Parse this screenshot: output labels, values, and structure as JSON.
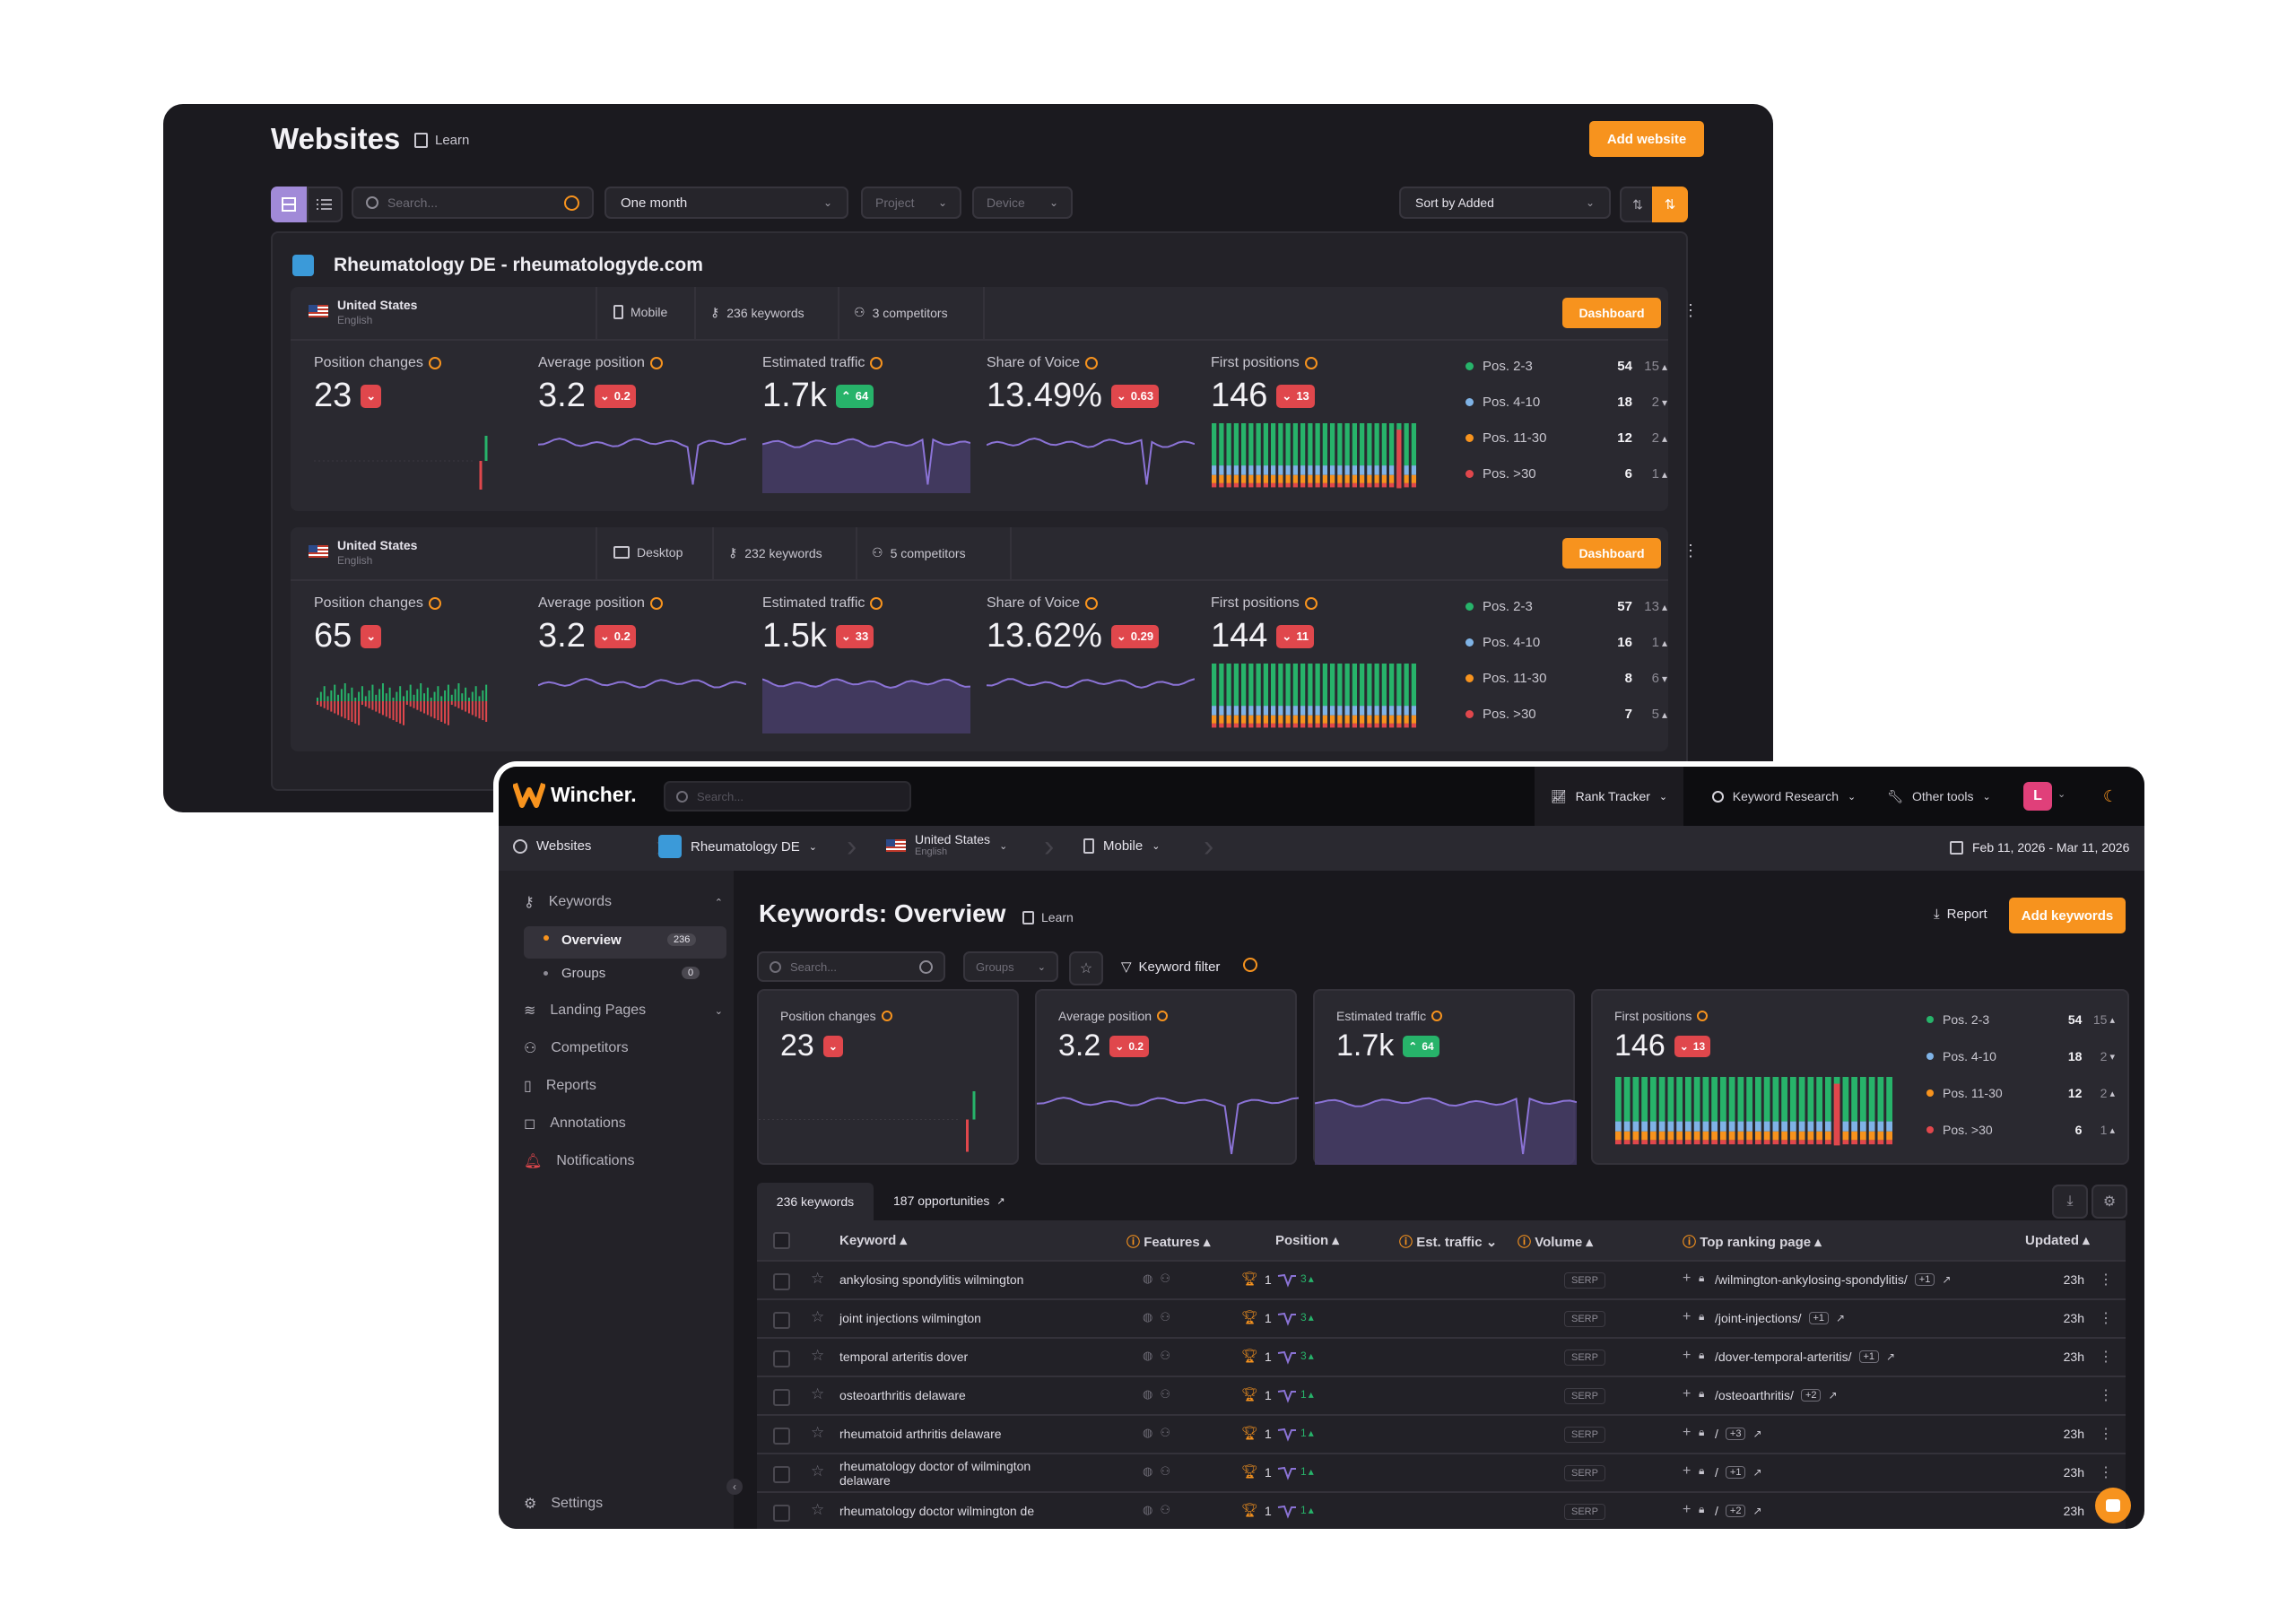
{
  "back": {
    "title": "Websites",
    "learn": "Learn",
    "add_website": "Add website",
    "search_placeholder": "Search...",
    "period": "One month",
    "project": "Project",
    "device": "Device",
    "sort": "Sort by Added",
    "site_title": "Rheumatology DE - rheumatologyde.com",
    "panels": [
      {
        "country": "United States",
        "language": "English",
        "device": "Mobile",
        "keywords": "236 keywords",
        "competitors": "3 competitors",
        "dashboard": "Dashboard",
        "metrics": [
          {
            "label": "Position changes",
            "value": "23",
            "badge": "",
            "dir": "down"
          },
          {
            "label": "Average position",
            "value": "3.2",
            "badge": "0.2",
            "dir": "down"
          },
          {
            "label": "Estimated traffic",
            "value": "1.7k",
            "badge": "64",
            "dir": "up"
          },
          {
            "label": "Share of Voice",
            "value": "13.49%",
            "badge": "0.63",
            "dir": "down"
          },
          {
            "label": "First positions",
            "value": "146",
            "badge": "13",
            "dir": "down"
          }
        ],
        "positions": [
          {
            "label": "Pos. 2-3",
            "value": "54",
            "delta": "15",
            "dir": "up",
            "color": "#27b36a"
          },
          {
            "label": "Pos. 4-10",
            "value": "18",
            "delta": "2",
            "dir": "down",
            "color": "#7fb3e6"
          },
          {
            "label": "Pos. 11-30",
            "value": "12",
            "delta": "2",
            "dir": "up",
            "color": "#f7931e"
          },
          {
            "label": "Pos. >30",
            "value": "6",
            "delta": "1",
            "dir": "up",
            "color": "#e0474c"
          }
        ]
      },
      {
        "country": "United States",
        "language": "English",
        "device": "Desktop",
        "keywords": "232 keywords",
        "competitors": "5 competitors",
        "dashboard": "Dashboard",
        "metrics": [
          {
            "label": "Position changes",
            "value": "65",
            "badge": "",
            "dir": "down"
          },
          {
            "label": "Average position",
            "value": "3.2",
            "badge": "0.2",
            "dir": "down"
          },
          {
            "label": "Estimated traffic",
            "value": "1.5k",
            "badge": "33",
            "dir": "down"
          },
          {
            "label": "Share of Voice",
            "value": "13.62%",
            "badge": "0.29",
            "dir": "down"
          },
          {
            "label": "First positions",
            "value": "144",
            "badge": "11",
            "dir": "down"
          }
        ],
        "positions": [
          {
            "label": "Pos. 2-3",
            "value": "57",
            "delta": "13",
            "dir": "up",
            "color": "#27b36a"
          },
          {
            "label": "Pos. 4-10",
            "value": "16",
            "delta": "1",
            "dir": "up",
            "color": "#7fb3e6"
          },
          {
            "label": "Pos. 11-30",
            "value": "8",
            "delta": "6",
            "dir": "down",
            "color": "#f7931e"
          },
          {
            "label": "Pos. >30",
            "value": "7",
            "delta": "5",
            "dir": "up",
            "color": "#e0474c"
          }
        ]
      }
    ]
  },
  "front": {
    "brand": "Wincher.",
    "search_placeholder": "Search...",
    "nav": {
      "rank_tracker": "Rank Tracker",
      "keyword_research": "Keyword Research",
      "other_tools": "Other tools",
      "avatar": "L"
    },
    "breadcrumb": {
      "websites": "Websites",
      "site": "Rheumatology DE",
      "country": "United States",
      "language": "English",
      "device": "Mobile"
    },
    "date_range": "Feb 11, 2026 - Mar 11, 2026",
    "sidebar": {
      "keywords": "Keywords",
      "overview": "Overview",
      "overview_count": "236",
      "groups": "Groups",
      "groups_count": "0",
      "landing_pages": "Landing Pages",
      "competitors": "Competitors",
      "reports": "Reports",
      "annotations": "Annotations",
      "notifications": "Notifications",
      "settings": "Settings"
    },
    "page_title": "Keywords: Overview",
    "learn": "Learn",
    "report": "Report",
    "add_keywords": "Add keywords",
    "groups_select": "Groups",
    "keyword_filter": "Keyword filter",
    "metrics": [
      {
        "label": "Position changes",
        "value": "23",
        "badge": "",
        "dir": "down"
      },
      {
        "label": "Average position",
        "value": "3.2",
        "badge": "0.2",
        "dir": "down"
      },
      {
        "label": "Estimated traffic",
        "value": "1.7k",
        "badge": "64",
        "dir": "up"
      },
      {
        "label": "First positions",
        "value": "146",
        "badge": "13",
        "dir": "down"
      }
    ],
    "positions": [
      {
        "label": "Pos. 2-3",
        "value": "54",
        "delta": "15",
        "dir": "up",
        "color": "#27b36a"
      },
      {
        "label": "Pos. 4-10",
        "value": "18",
        "delta": "2",
        "dir": "down",
        "color": "#7fb3e6"
      },
      {
        "label": "Pos. 11-30",
        "value": "12",
        "delta": "2",
        "dir": "up",
        "color": "#f7931e"
      },
      {
        "label": "Pos. >30",
        "value": "6",
        "delta": "1",
        "dir": "up",
        "color": "#e0474c"
      }
    ],
    "tabs": {
      "keywords": "236 keywords",
      "opportunities": "187 opportunities"
    },
    "columns": {
      "keyword": "Keyword",
      "features": "Features",
      "position": "Position",
      "est_traffic": "Est. traffic",
      "volume": "Volume",
      "top_page": "Top ranking page",
      "updated": "Updated"
    },
    "rows": [
      {
        "keyword": "ankylosing spondylitis wilmington",
        "position": "1",
        "change": "3",
        "serp": "SERP",
        "page": "/wilmington-ankylosing-spondylitis/",
        "extra": "+1",
        "updated": "23h"
      },
      {
        "keyword": "joint injections wilmington",
        "position": "1",
        "change": "3",
        "serp": "SERP",
        "page": "/joint-injections/",
        "extra": "+1",
        "updated": "23h"
      },
      {
        "keyword": "temporal arteritis dover",
        "position": "1",
        "change": "3",
        "serp": "SERP",
        "page": "/dover-temporal-arteritis/",
        "extra": "+1",
        "updated": "23h"
      },
      {
        "keyword": "osteoarthritis delaware",
        "position": "1",
        "change": "1",
        "serp": "SERP",
        "page": "/osteoarthritis/",
        "extra": "+2",
        "updated": ""
      },
      {
        "keyword": "rheumatoid arthritis delaware",
        "position": "1",
        "change": "1",
        "serp": "SERP",
        "page": "/",
        "extra": "+3",
        "updated": "23h"
      },
      {
        "keyword": "rheumatology doctor of wilmington delaware",
        "position": "1",
        "change": "1",
        "serp": "SERP",
        "page": "/",
        "extra": "+1",
        "updated": "23h"
      },
      {
        "keyword": "rheumatology doctor wilmington de",
        "position": "1",
        "change": "1",
        "serp": "SERP",
        "page": "/",
        "extra": "+2",
        "updated": "23h"
      }
    ]
  },
  "colors": {
    "accent": "#f7931e",
    "red": "#e0474c",
    "green": "#27b36a",
    "purple": "#a18ad8",
    "avatar": "#e0407a"
  }
}
